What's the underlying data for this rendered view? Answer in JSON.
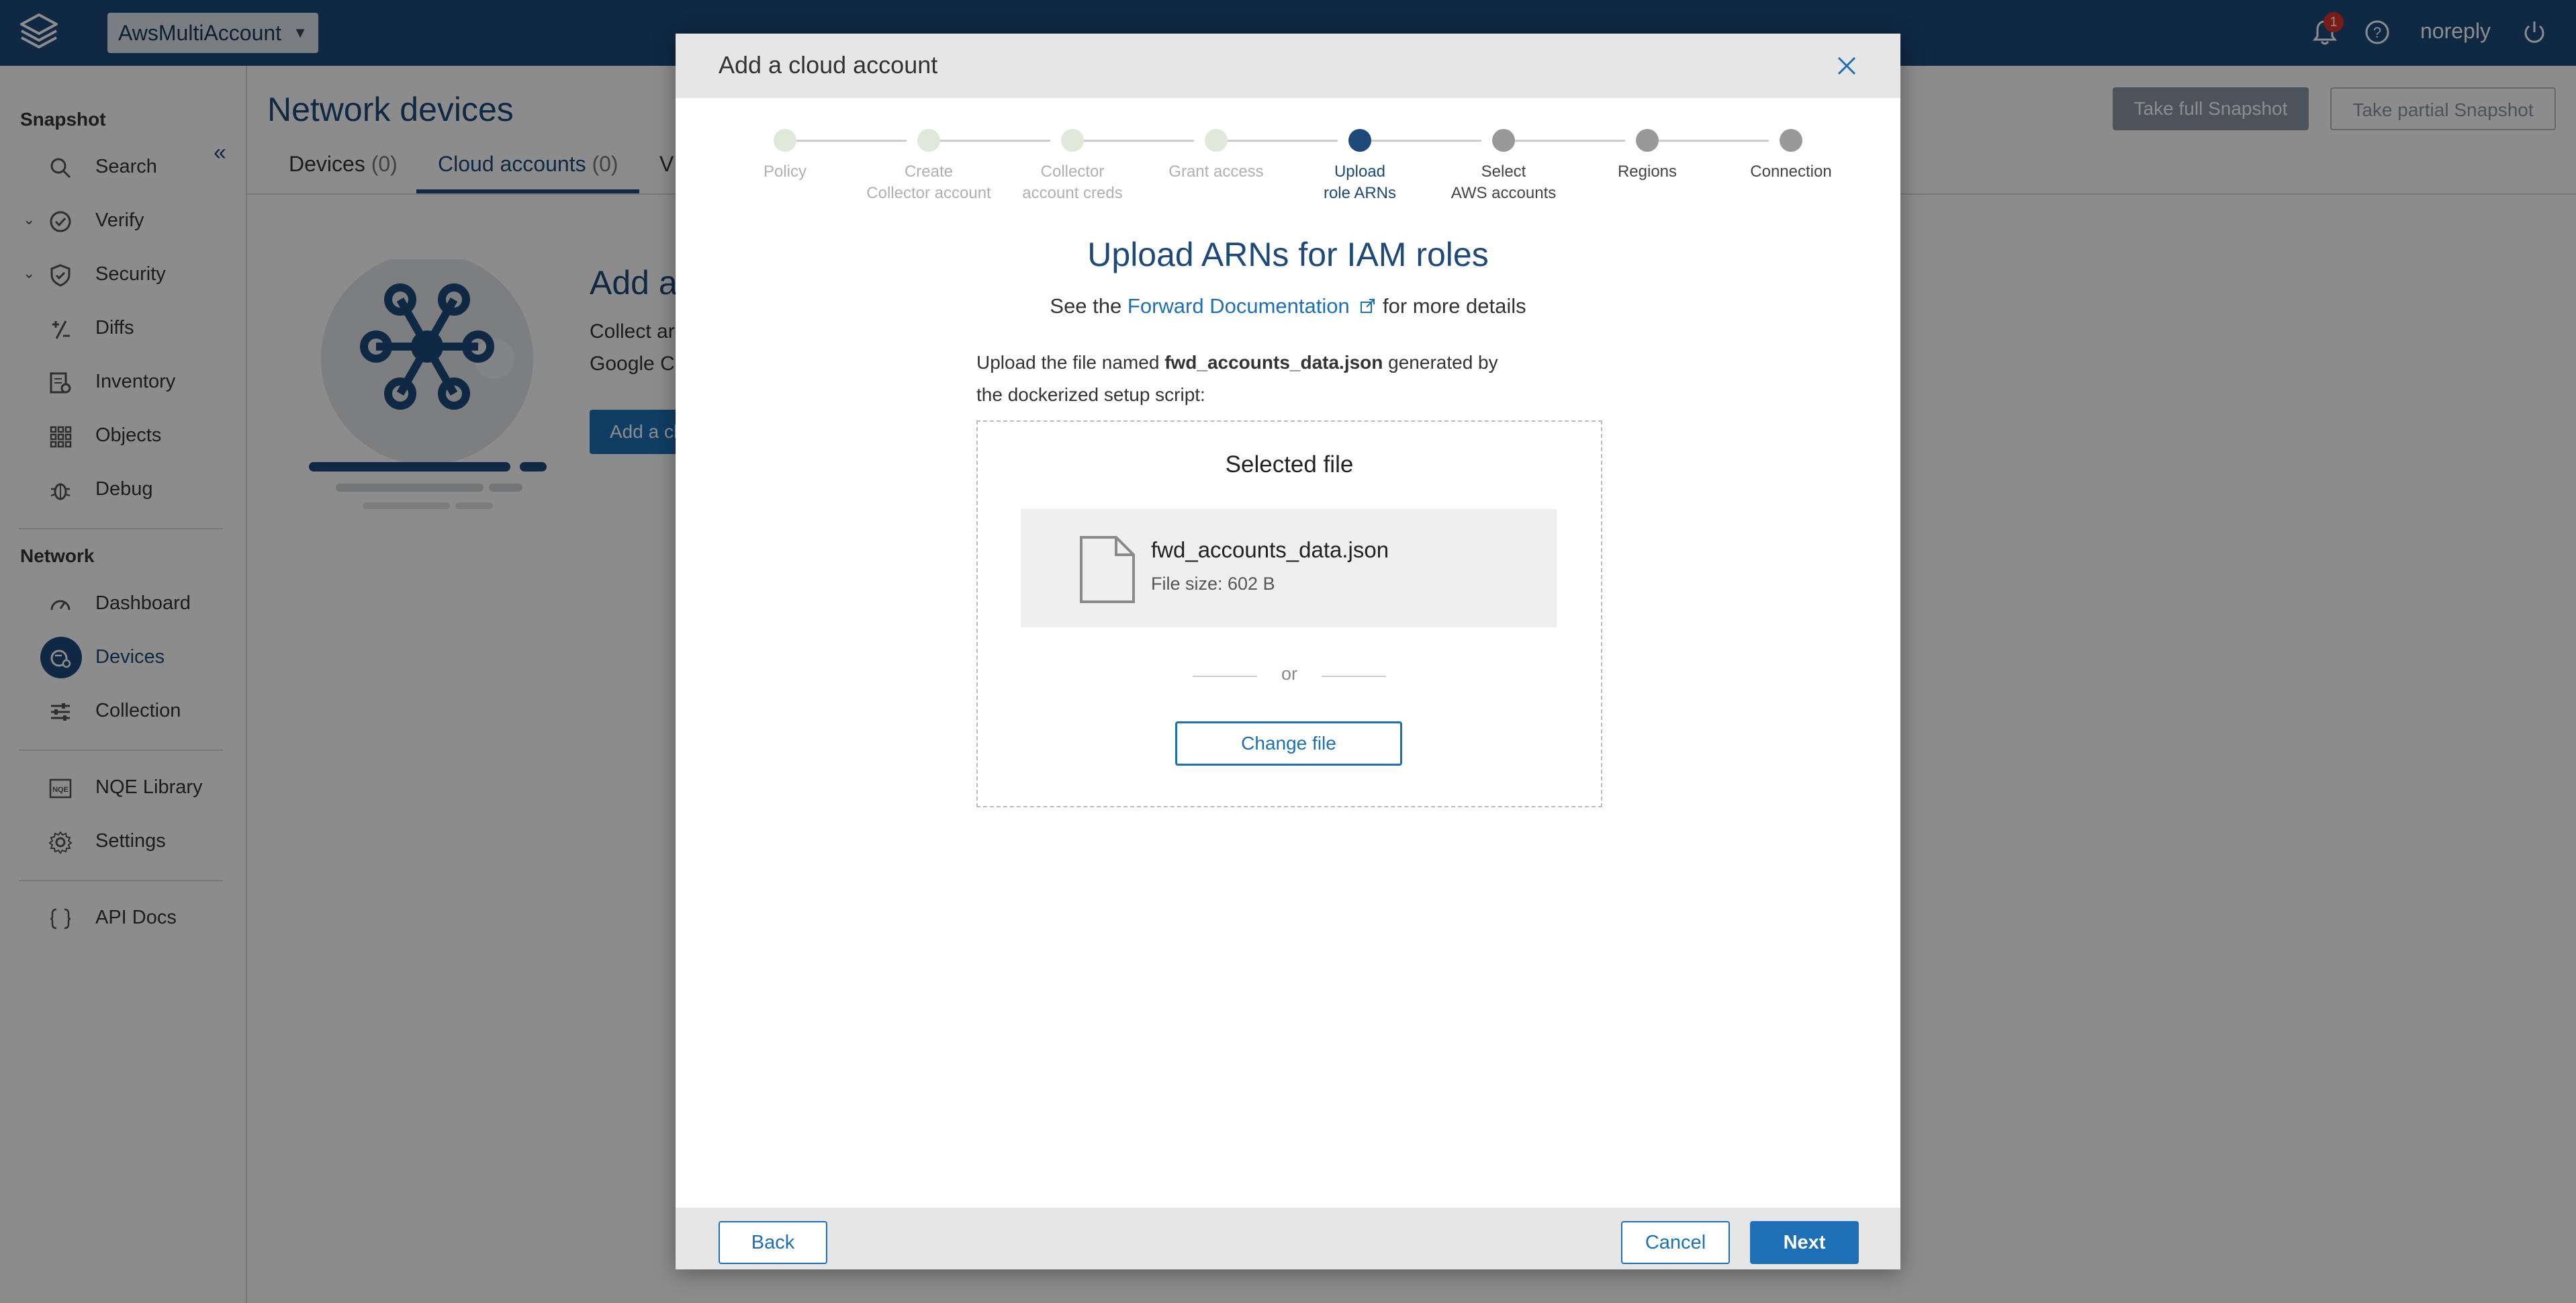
{
  "topbar": {
    "workspace": "AwsMultiAccount",
    "notification_count": "1",
    "user": "noreply",
    "icons": [
      "logo-icon",
      "bell-icon",
      "help-icon",
      "power-icon"
    ]
  },
  "sidebar": {
    "snapshot_heading": "Snapshot",
    "snapshot_items": [
      {
        "label": "Search",
        "icon": "search-icon"
      },
      {
        "label": "Verify",
        "icon": "check-circle-icon"
      },
      {
        "label": "Security",
        "icon": "shield-icon"
      },
      {
        "label": "Diffs",
        "icon": "diff-icon"
      },
      {
        "label": "Inventory",
        "icon": "inventory-icon"
      },
      {
        "label": "Objects",
        "icon": "grid-icon"
      },
      {
        "label": "Debug",
        "icon": "bug-icon"
      }
    ],
    "network_heading": "Network",
    "network_items": [
      {
        "label": "Dashboard",
        "icon": "gauge-icon"
      },
      {
        "label": "Devices",
        "icon": "devices-icon"
      },
      {
        "label": "Collection",
        "icon": "sliders-icon"
      }
    ],
    "other_items": [
      {
        "label": "NQE Library",
        "icon": "nqe-icon"
      },
      {
        "label": "Settings",
        "icon": "gear-icon"
      }
    ],
    "api_item": {
      "label": "API Docs",
      "icon": "braces-icon"
    }
  },
  "page": {
    "title": "Network devices",
    "tabs": [
      {
        "label": "Devices",
        "count": "(0)"
      },
      {
        "label": "Cloud accounts",
        "count": "(0)"
      },
      {
        "label": "V",
        "count": ""
      }
    ],
    "full_snapshot": "Take full Snapshot",
    "partial_snapshot": "Take partial Snapshot",
    "add_title": "Add a",
    "add_desc_1": "Collect ar",
    "add_desc_2": "Google C",
    "add_button": "Add a cl"
  },
  "modal": {
    "title": "Add a cloud account",
    "steps": [
      {
        "line1": "Policy",
        "line2": "",
        "state": "done"
      },
      {
        "line1": "Create",
        "line2": "Collector account",
        "state": "done"
      },
      {
        "line1": "Collector",
        "line2": "account creds",
        "state": "done"
      },
      {
        "line1": "Grant access",
        "line2": "",
        "state": "done"
      },
      {
        "line1": "Upload",
        "line2": "role ARNs",
        "state": "current"
      },
      {
        "line1": "Select",
        "line2": "AWS accounts",
        "state": "todo"
      },
      {
        "line1": "Regions",
        "line2": "",
        "state": "todo"
      },
      {
        "line1": "Connection",
        "line2": "",
        "state": "todo"
      }
    ],
    "heading": "Upload ARNs for IAM roles",
    "sub_prefix": "See the",
    "sub_link": "Forward Documentation",
    "sub_suffix": "for more details",
    "instr_prefix": "Upload the file named",
    "instr_file": "fwd_accounts_data.json",
    "instr_suffix": "generated by the dockerized setup script:",
    "selected_file_title": "Selected file",
    "file_name": "fwd_accounts_data.json",
    "file_size": "File size: 602 B",
    "or": "or",
    "change_file": "Change file",
    "back": "Back",
    "cancel": "Cancel",
    "next": "Next"
  },
  "colors": {
    "brand": "#1d4a7a",
    "accent": "#1d6fb6",
    "notification": "#d9342b"
  }
}
